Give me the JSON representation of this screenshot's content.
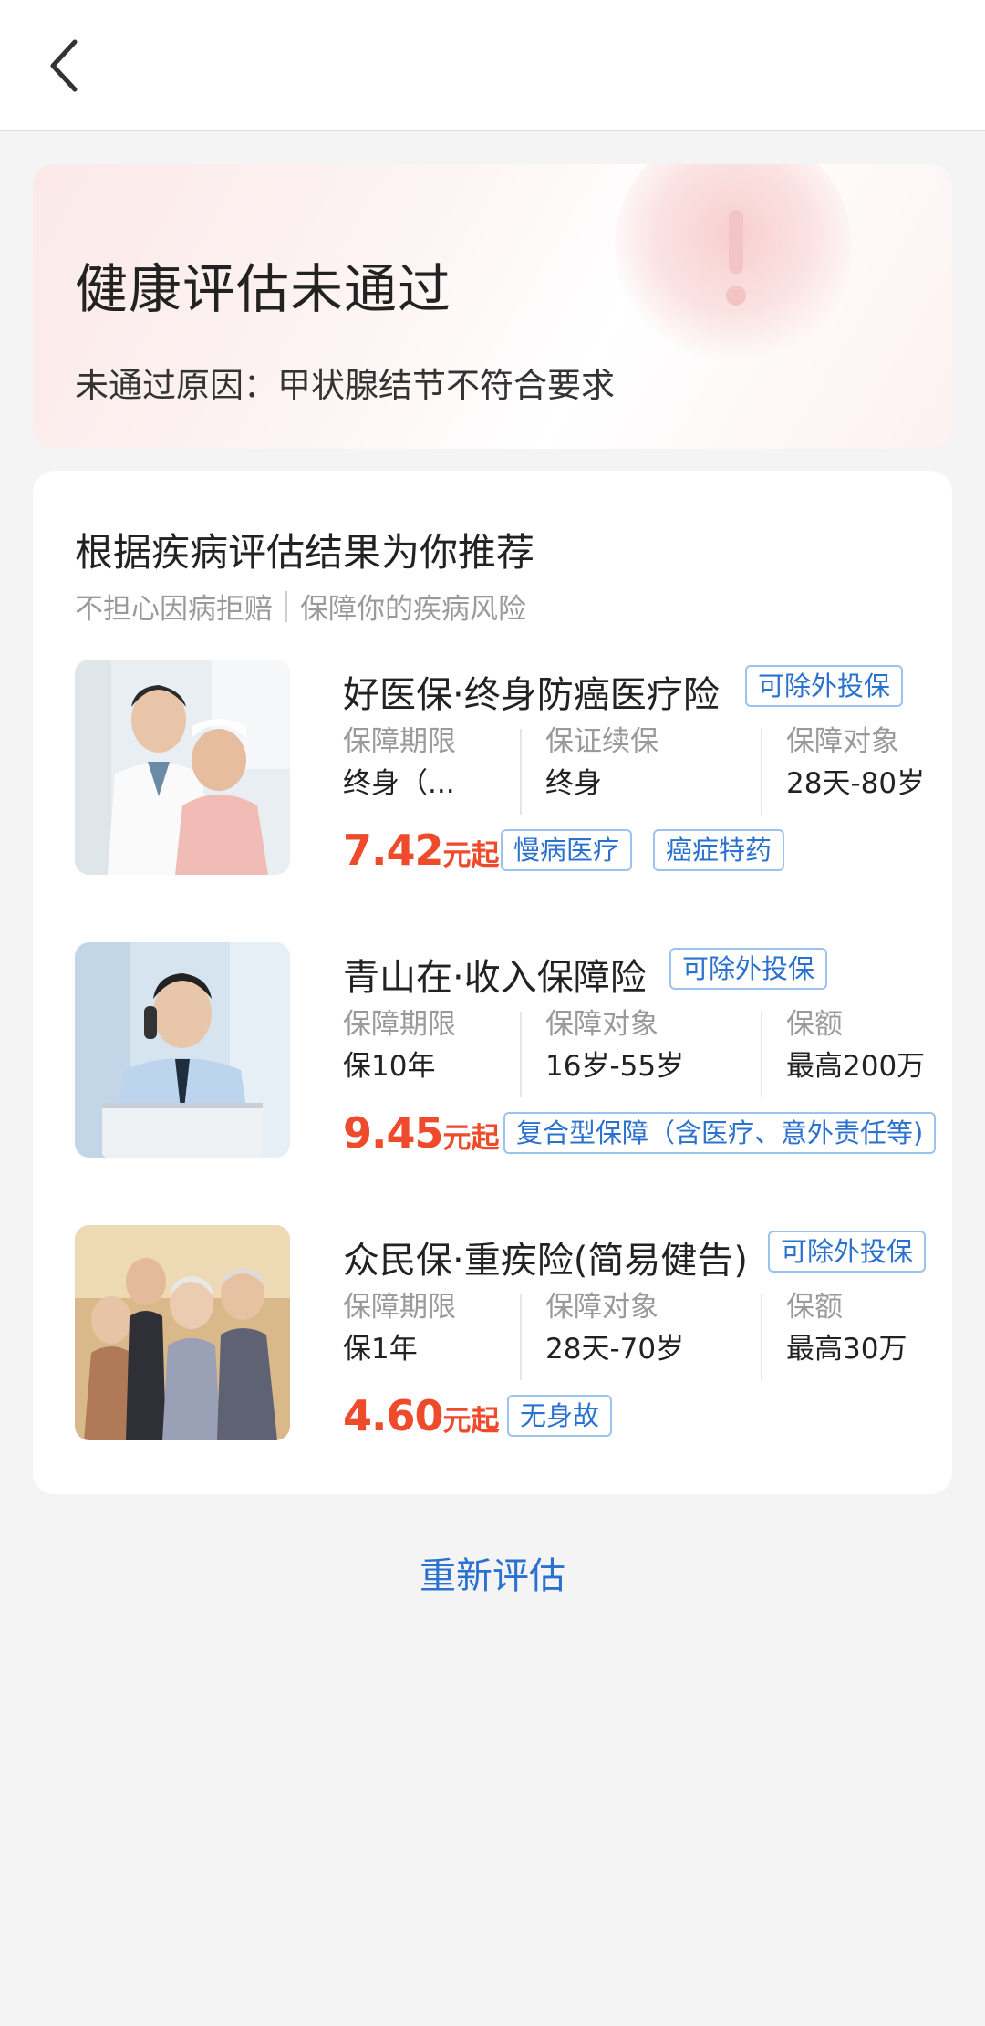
{
  "header": {
    "back_icon": "chevron-left-icon"
  },
  "result": {
    "title": "健康评估未通过",
    "reason": "未通过原因：甲状腺结节不符合要求",
    "accent_color": "#ee4a2c"
  },
  "recommend": {
    "title": "根据疾病评估结果为你推荐",
    "subtitle_left": "不担心因病拒赔",
    "subtitle_right": "保障你的疾病风险",
    "products": [
      {
        "name": "好医保·终身防癌医疗险",
        "badge": "可除外投保",
        "attrs": [
          {
            "label": "保障期限",
            "value": "终身（..."
          },
          {
            "label": "保证续保",
            "value": "终身"
          },
          {
            "label": "保障对象",
            "value": "28天-80岁"
          }
        ],
        "price": "7.42",
        "price_unit": "元起",
        "features": [
          "慢病医疗",
          "癌症特药"
        ],
        "image": "doctor-and-elderly-patient-photo"
      },
      {
        "name": "青山在·收入保障险",
        "badge": "可除外投保",
        "attrs": [
          {
            "label": "保障期限",
            "value": "保10年"
          },
          {
            "label": "保障对象",
            "value": "16岁-55岁"
          },
          {
            "label": "保额",
            "value": "最高200万"
          }
        ],
        "price": "9.45",
        "price_unit": "元起",
        "features": [
          "复合型保障（含医疗、意外责任等)"
        ],
        "image": "businessman-on-phone-photo"
      },
      {
        "name": "众民保·重疾险(简易健告)",
        "badge": "可除外投保",
        "attrs": [
          {
            "label": "保障期限",
            "value": "保1年"
          },
          {
            "label": "保障对象",
            "value": "28天-70岁"
          },
          {
            "label": "保额",
            "value": "最高30万"
          }
        ],
        "price": "4.60",
        "price_unit": "元起",
        "features": [
          "无身故"
        ],
        "image": "family-group-photo"
      }
    ]
  },
  "footer": {
    "reassess_label": "重新评估",
    "link_color": "#2b72d0"
  }
}
